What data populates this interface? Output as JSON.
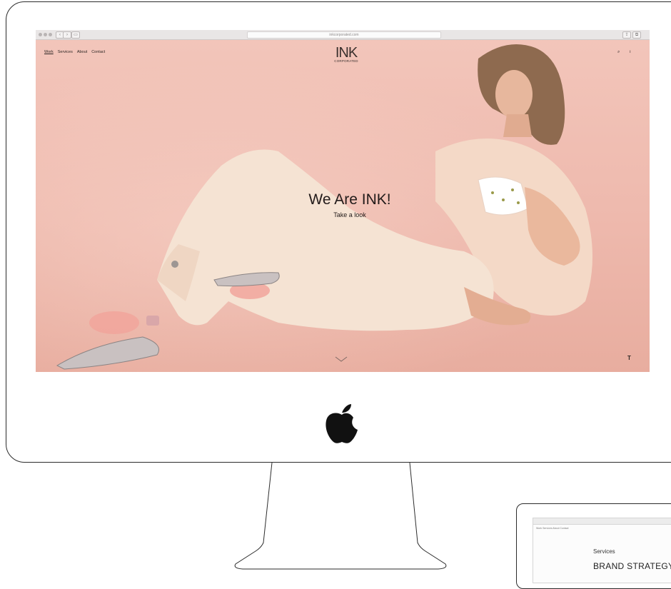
{
  "browser": {
    "url": "inkcorporated.com",
    "back_glyph": "‹",
    "forward_glyph": "›",
    "sidebar_glyph": "▭",
    "share_glyph": "⇪",
    "tabs_glyph": "⧉"
  },
  "site": {
    "nav": {
      "work": "Work",
      "services": "Services",
      "about": "About",
      "contact": "Contact"
    },
    "logo_main": "INK",
    "logo_sub": "CORPORATED",
    "icon_search": "⌕",
    "icon_user": "ı",
    "hero_title": "We Are INK!",
    "hero_sub": "Take a look",
    "corner_label": "T"
  },
  "laptop": {
    "nav_text": "Work  Services  About  Contact",
    "services_heading": "Services",
    "brand_strategy": "BRAND STRATEGY"
  },
  "colors": {
    "screen_bg": "#f0c2b6",
    "outline": "#2b2b2b"
  },
  "icons": [
    "apple-logo-icon",
    "chevron-down-icon",
    "search-icon",
    "user-icon"
  ]
}
